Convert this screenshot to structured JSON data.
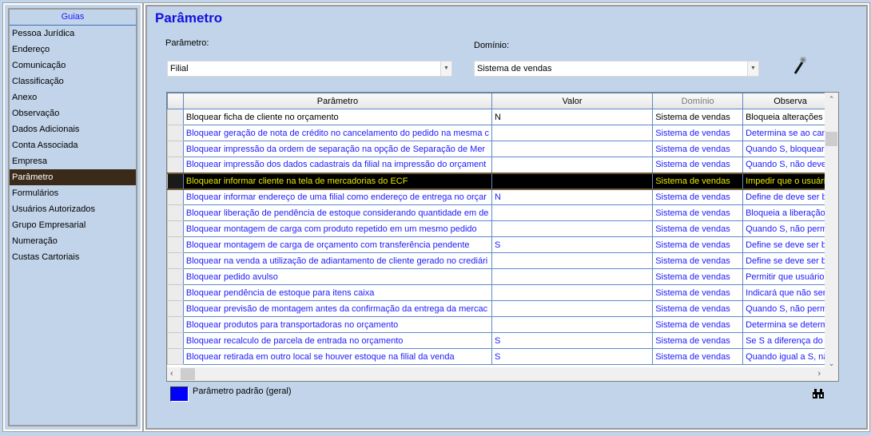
{
  "sidebar": {
    "title": "Guias",
    "items": [
      "Pessoa Jurídica",
      "Endereço",
      "Comunicação",
      "Classificação",
      "Anexo",
      "Observação",
      "Dados Adicionais",
      "Conta Associada",
      "Empresa",
      "Parâmetro",
      "Formulários",
      "Usuários Autorizados",
      "Grupo Empresarial",
      "Numeração",
      "Custas Cartoriais"
    ],
    "selected": "Parâmetro"
  },
  "main": {
    "title": "Parâmetro",
    "param_label": "Parâmetro:",
    "param_value": "Filial",
    "domain_label": "Domínio:",
    "domain_value": "Sistema de vendas"
  },
  "table": {
    "columns": [
      "Parâmetro",
      "Valor",
      "Domínio",
      "Observa"
    ],
    "rows": [
      {
        "p": "Bloquear ficha de cliente no orçamento",
        "v": "N",
        "d": "Sistema de vendas",
        "o": "Bloqueia alterações na",
        "style": "black"
      },
      {
        "p": "Bloquear geração de nota de crédito no cancelamento do pedido na mesma c",
        "v": "",
        "d": "Sistema de vendas",
        "o": "Determina se ao canc",
        "style": "blue"
      },
      {
        "p": "Bloquear impressão da ordem de separação na opção de Separação de Mer",
        "v": "",
        "d": "Sistema de vendas",
        "o": "Quando S, bloquear in",
        "style": "blue"
      },
      {
        "p": "Bloquear impressão dos dados cadastrais da filial na impressão do orçament",
        "v": "",
        "d": "Sistema de vendas",
        "o": "Quando S, não deve i",
        "style": "blue"
      },
      {
        "p": "Bloquear informar cliente na tela de mercadorias do ECF",
        "v": "",
        "d": "Sistema de vendas",
        "o": "Impedir que o usuário",
        "style": "hl"
      },
      {
        "p": "Bloquear informar endereço de uma filial como endereço de entrega no orçar",
        "v": "N",
        "d": "Sistema de vendas",
        "o": "Define de deve ser blo",
        "style": "blue"
      },
      {
        "p": "Bloquear liberação de pendência de estoque considerando quantidade em de",
        "v": "",
        "d": "Sistema de vendas",
        "o": "Bloqueia a liberação d",
        "style": "blue"
      },
      {
        "p": "Bloquear montagem de carga com produto repetido em um mesmo pedido",
        "v": "",
        "d": "Sistema de vendas",
        "o": "Quando S, não permiti",
        "style": "blue"
      },
      {
        "p": "Bloquear montagem de carga de orçamento com transferência pendente",
        "v": "S",
        "d": "Sistema de vendas",
        "o": "Define se deve ser blo",
        "style": "blue"
      },
      {
        "p": "Bloquear na venda a utilização de adiantamento de cliente gerado no crediári",
        "v": "",
        "d": "Sistema de vendas",
        "o": "Define se deve ser blo",
        "style": "blue"
      },
      {
        "p": "Bloquear pedido avulso",
        "v": "",
        "d": "Sistema de vendas",
        "o": "Permitir que usuários",
        "style": "blue"
      },
      {
        "p": "Bloquear pendência de estoque para itens caixa",
        "v": "",
        "d": "Sistema de vendas",
        "o": "Indicará que não será",
        "style": "blue"
      },
      {
        "p": "Bloquear previsão de montagem antes da confirmação da entrega da mercac",
        "v": "",
        "d": "Sistema de vendas",
        "o": "Quando S, não permiti",
        "style": "blue"
      },
      {
        "p": "Bloquear produtos para transportadoras no orçamento",
        "v": "",
        "d": "Sistema de vendas",
        "o": "Determina  se determi",
        "style": "blue"
      },
      {
        "p": "Bloquear recalculo de parcela de entrada no orçamento",
        "v": "S",
        "d": "Sistema de vendas",
        "o": "Se S a diferença do v",
        "style": "blue"
      },
      {
        "p": "Bloquear retirada em outro local se houver estoque na filial da venda",
        "v": "S",
        "d": "Sistema de vendas",
        "o": "Quando igual a S, não",
        "style": "blue"
      }
    ]
  },
  "legend": {
    "label": "Parâmetro padrão (geral)",
    "color": "#0000ff"
  }
}
